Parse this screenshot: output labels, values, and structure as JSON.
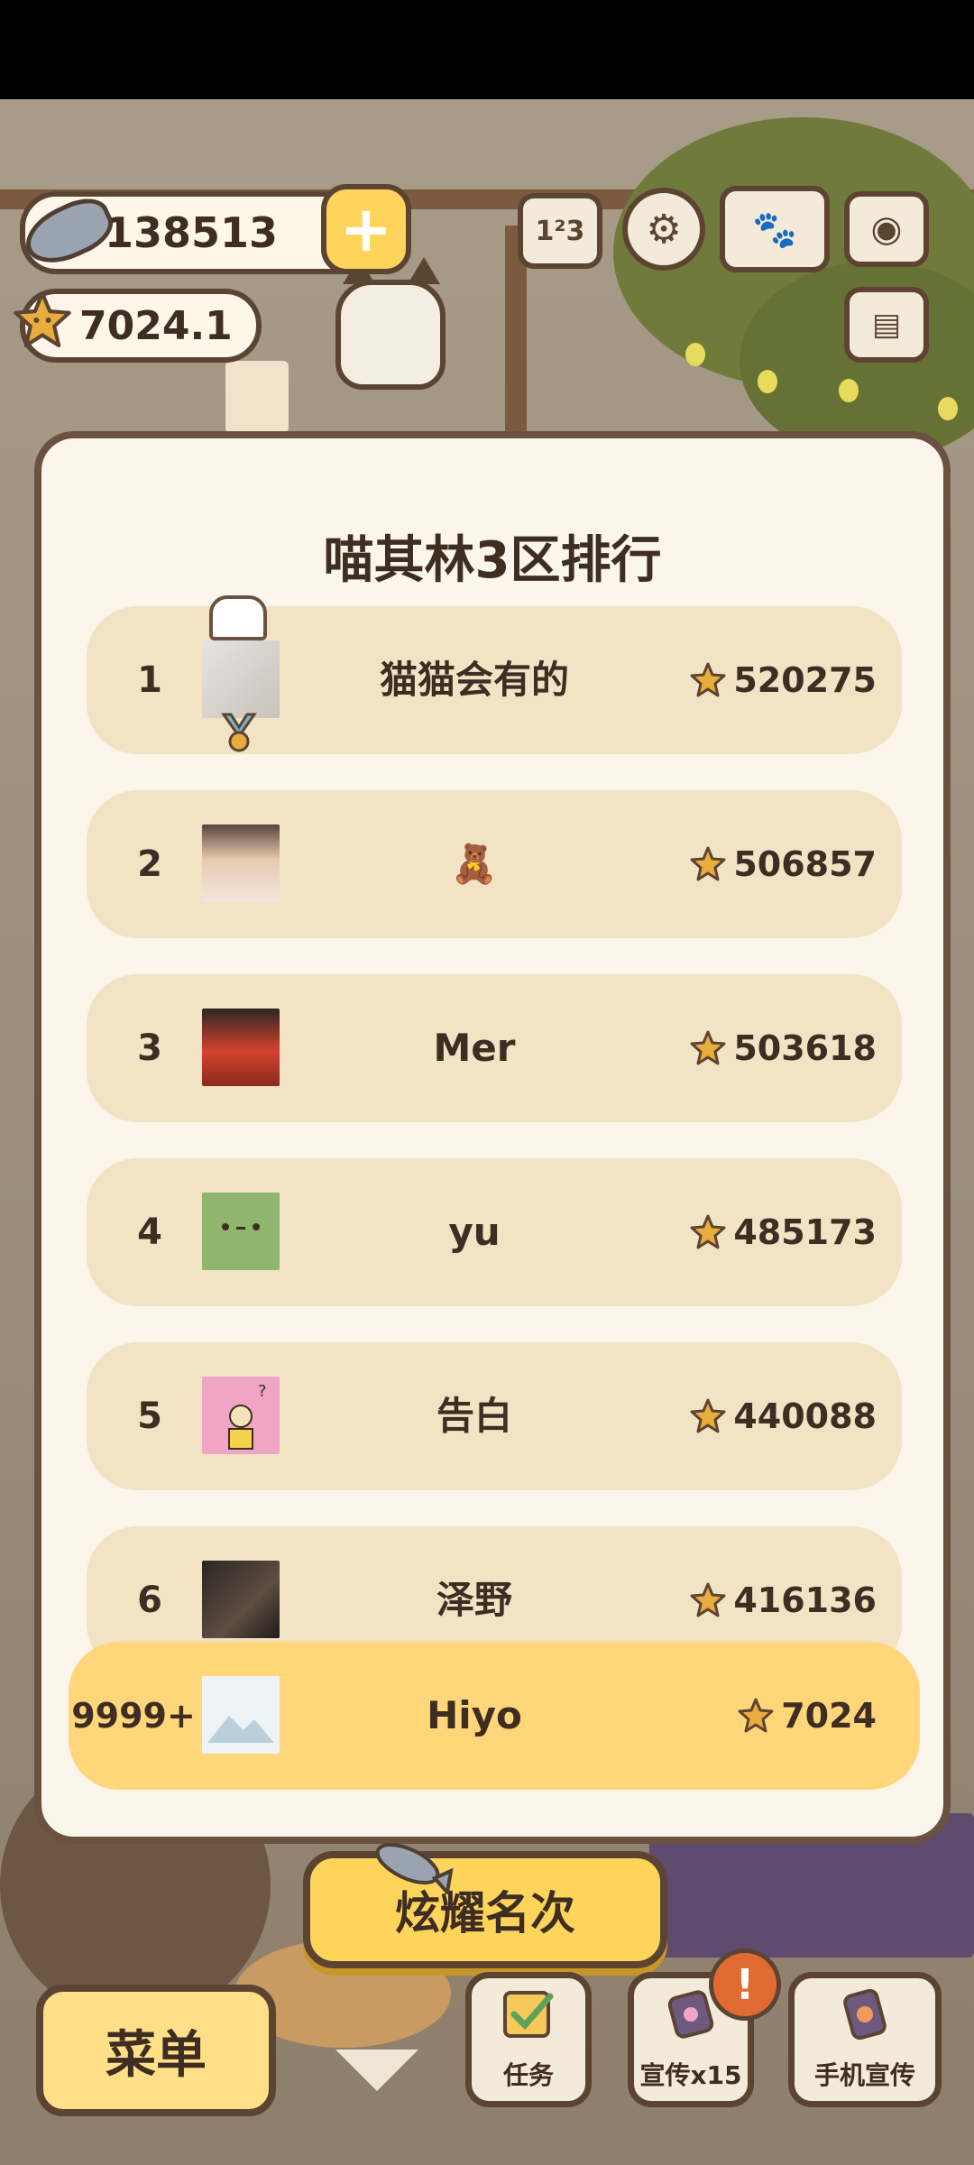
{
  "hud": {
    "fish_count": "138513",
    "star_count": "7024.1",
    "plus_label": "+"
  },
  "modal": {
    "title": "喵其林3区排行",
    "rows": [
      {
        "rank": "1",
        "name": "猫猫会有的",
        "score": "520275"
      },
      {
        "rank": "2",
        "name": "🧸",
        "score": "506857"
      },
      {
        "rank": "3",
        "name": "Mer",
        "score": "503618"
      },
      {
        "rank": "4",
        "name": "yu",
        "score": "485173"
      },
      {
        "rank": "5",
        "name": "告白",
        "score": "440088"
      },
      {
        "rank": "6",
        "name": "泽野",
        "score": "416136"
      }
    ],
    "me": {
      "rank": "9999+",
      "name": "Hiyo",
      "score": "7024"
    }
  },
  "bottom": {
    "show_rank_button": "炫耀名次",
    "menu_button": "菜单",
    "tasks_button": "任务",
    "promo_button": "宣传x15",
    "phone_promo_button": "手机宣传",
    "alert_mark": "!"
  },
  "icons": {
    "fish": "fish-icon",
    "star": "star-icon",
    "ranking": "ranking-podium-icon",
    "settings": "gear-icon",
    "book": "book-icon",
    "camera": "camera-icon",
    "news": "newspaper-icon",
    "chef_hat": "chef-hat-icon",
    "medal": "medal-icon",
    "checkbox": "checklist-icon",
    "megaphone": "promo-card-icon",
    "phone": "phone-promo-icon",
    "arrow": "chevron-down-icon"
  },
  "colors": {
    "accent_yellow": "#ffd45a",
    "row_bg": "#f2e3c4",
    "my_row_bg": "#ffd67a",
    "outline_brown": "#5c4433",
    "star_orange": "#e3a63b"
  }
}
